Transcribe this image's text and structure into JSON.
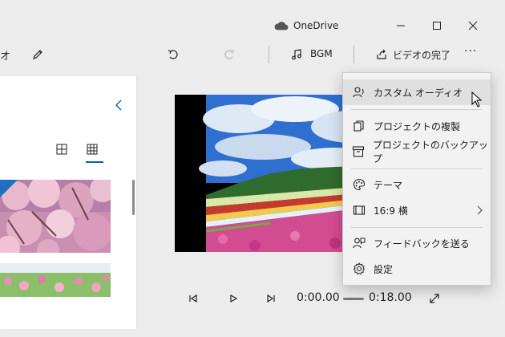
{
  "window": {
    "title": "OneDrive"
  },
  "toolbar": {
    "left_fragment": "オ",
    "bgm_label": "BGM",
    "finish_label": "ビデオの完了",
    "more_label": "···"
  },
  "playback": {
    "current_time": "0:00.00",
    "total_time": "0:18.00",
    "progress": 0
  },
  "menu": {
    "items": [
      {
        "label": "カスタム オーディオ",
        "icon": "person-audio-icon"
      },
      {
        "label": "プロジェクトの複製",
        "icon": "copy-icon"
      },
      {
        "label": "プロジェクトのバックアップ",
        "icon": "archive-icon"
      },
      {
        "label": "テーマ",
        "icon": "palette-icon"
      },
      {
        "label": "16:9 横",
        "icon": "aspect-ratio-icon"
      },
      {
        "label": "フィードバックを送る",
        "icon": "feedback-icon"
      },
      {
        "label": "設定",
        "icon": "gear-icon"
      }
    ]
  },
  "colors": {
    "accent": "#0063b1",
    "menu_bg": "#f2f2f2",
    "menu_hover": "#e0e0e0",
    "window_bg": "#ececec"
  }
}
